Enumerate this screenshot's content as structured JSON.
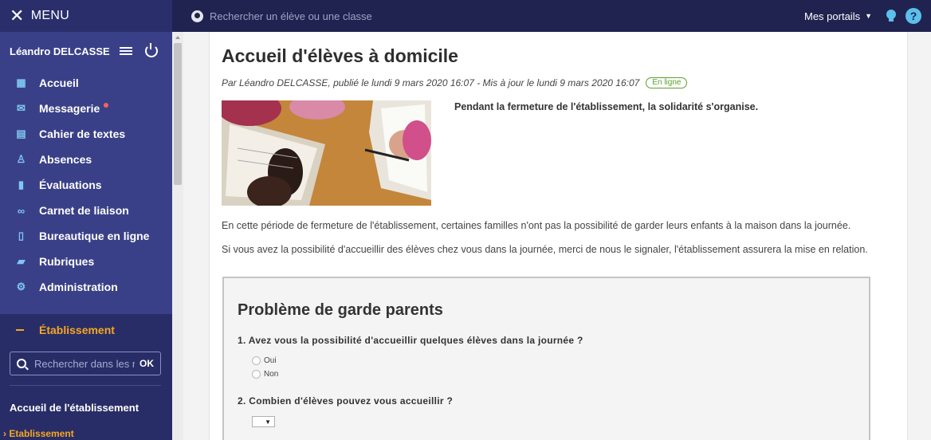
{
  "topbar": {
    "menu_label": "MENU",
    "search_placeholder": "Rechercher un élève ou une classe",
    "portails_label": "Mes portails",
    "help_label": "?"
  },
  "sidebar": {
    "user_name": "Léandro DELCASSE",
    "items": [
      {
        "label": "Accueil",
        "icon": "dashboard-icon"
      },
      {
        "label": "Messagerie",
        "icon": "mail-icon"
      },
      {
        "label": "Cahier de textes",
        "icon": "calendar-icon"
      },
      {
        "label": "Absences",
        "icon": "person-icon"
      },
      {
        "label": "Évaluations",
        "icon": "bar-chart-icon"
      },
      {
        "label": "Carnet de liaison",
        "icon": "link-icon"
      },
      {
        "label": "Bureautique en ligne",
        "icon": "file-icon"
      },
      {
        "label": "Rubriques",
        "icon": "folder-icon"
      },
      {
        "label": "Administration",
        "icon": "gear-icon"
      }
    ],
    "etablissement": {
      "heading": "Établissement",
      "search_placeholder": "Rechercher dans les ru",
      "ok_label": "OK",
      "accueil_label": "Accueil de l'établissement",
      "link_label": "Etablissement"
    }
  },
  "article": {
    "title": "Accueil d'élèves à domicile",
    "byline": "Par Léandro DELCASSE, publié le lundi 9 mars 2020 16:07 - Mis à jour le lundi 9 mars 2020 16:07",
    "status_badge": "En ligne",
    "intro_bold": "Pendant la fermeture de l'établissement, la solidarité s'organise.",
    "paragraph1": "En cette période de fermeture de l'établissement, certaines familles n'ont pas la possibilité de garder leurs enfants à la maison dans la journée.",
    "paragraph2": "Si vous avez la possibilité d'accueillir des élèves chez vous dans la journée, merci de nous le signaler, l'établissement assurera la mise en relation."
  },
  "form": {
    "title": "Problème de garde parents",
    "q1": "1. Avez vous la possibilité d'accueillir quelques élèves dans la journée ?",
    "q1_options": [
      "Oui",
      "Non"
    ],
    "q2": "2. Combien d'élèves pouvez vous accueillir ?",
    "q2_select_arrow": "▼"
  },
  "colors": {
    "topbar": "#202350",
    "sidebar": "#3a4088",
    "accent_orange": "#f5a623",
    "accent_blue": "#5bc0eb",
    "badge_green": "#5aa02c"
  }
}
